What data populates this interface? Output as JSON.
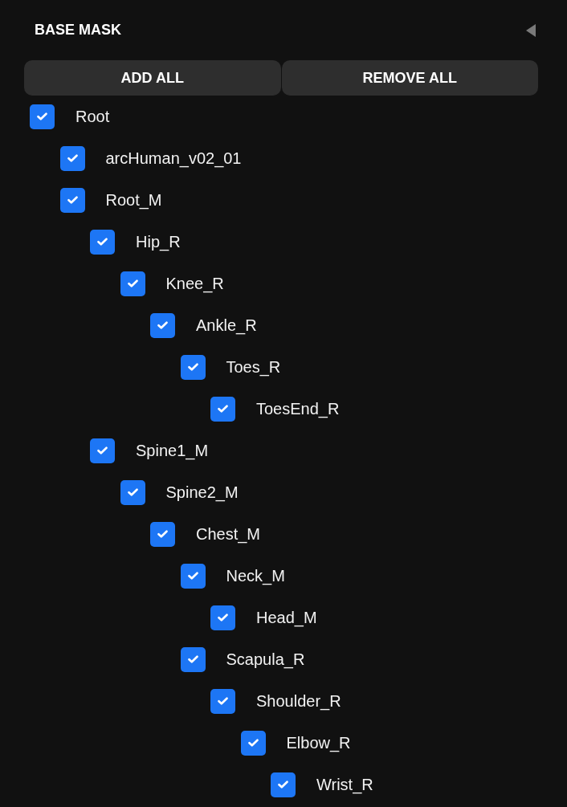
{
  "header": {
    "title": "BASE MASK"
  },
  "buttons": [
    {
      "label": "ADD ALL"
    },
    {
      "label": "REMOVE ALL"
    }
  ],
  "tree": [
    {
      "label": "Root",
      "checked": true,
      "children": [
        {
          "label": "arcHuman_v02_01",
          "checked": true
        },
        {
          "label": "Root_M",
          "checked": true,
          "children": [
            {
              "label": "Hip_R",
              "checked": true,
              "children": [
                {
                  "label": "Knee_R",
                  "checked": true,
                  "children": [
                    {
                      "label": "Ankle_R",
                      "checked": true,
                      "children": [
                        {
                          "label": "Toes_R",
                          "checked": true,
                          "children": [
                            {
                              "label": "ToesEnd_R",
                              "checked": true
                            }
                          ]
                        }
                      ]
                    }
                  ]
                }
              ]
            },
            {
              "label": "Spine1_M",
              "checked": true,
              "children": [
                {
                  "label": "Spine2_M",
                  "checked": true,
                  "children": [
                    {
                      "label": "Chest_M",
                      "checked": true,
                      "children": [
                        {
                          "label": "Neck_M",
                          "checked": true,
                          "children": [
                            {
                              "label": "Head_M",
                              "checked": true
                            }
                          ]
                        },
                        {
                          "label": "Scapula_R",
                          "checked": true,
                          "children": [
                            {
                              "label": "Shoulder_R",
                              "checked": true,
                              "children": [
                                {
                                  "label": "Elbow_R",
                                  "checked": true,
                                  "children": [
                                    {
                                      "label": "Wrist_R",
                                      "checked": true
                                    }
                                  ]
                                }
                              ]
                            }
                          ]
                        }
                      ]
                    }
                  ]
                }
              ]
            }
          ]
        }
      ]
    }
  ]
}
